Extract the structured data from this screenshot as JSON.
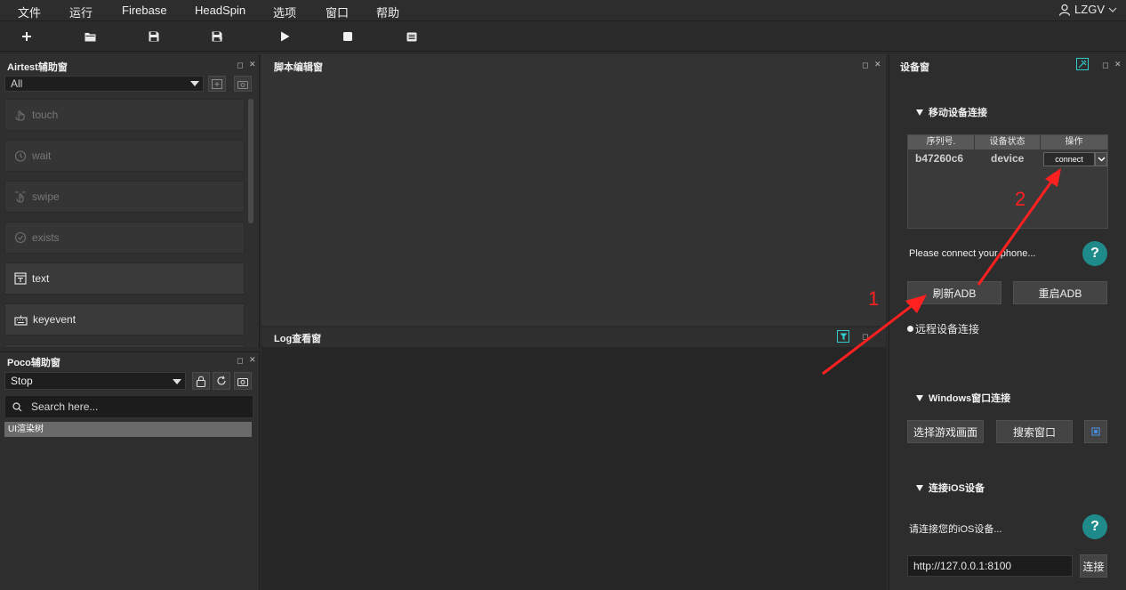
{
  "menubar": {
    "items": [
      "文件",
      "运行",
      "Firebase",
      "HeadSpin",
      "选项",
      "窗口",
      "帮助"
    ],
    "user": "LZGV"
  },
  "toolbar": {
    "buttons": [
      "new-icon",
      "open-folder-icon",
      "save-icon",
      "save-as-icon",
      "play-icon",
      "stop-icon",
      "log-icon"
    ]
  },
  "airtest": {
    "title": "Airtest辅助窗",
    "filter_value": "All",
    "apis": [
      {
        "label": "touch",
        "icon": "hand-icon",
        "enabled": false
      },
      {
        "label": "wait",
        "icon": "clock-icon",
        "enabled": false
      },
      {
        "label": "swipe",
        "icon": "swipe-hand-icon",
        "enabled": false
      },
      {
        "label": "exists",
        "icon": "check-circle-icon",
        "enabled": false
      },
      {
        "label": "text",
        "icon": "text-box-icon",
        "enabled": true
      },
      {
        "label": "keyevent",
        "icon": "keyboard-icon",
        "enabled": true
      }
    ]
  },
  "poco": {
    "title": "Poco辅助窗",
    "mode_value": "Stop",
    "search_placeholder": "Search here...",
    "tree_header": "UI渲染树"
  },
  "editor": {
    "title": "脚本编辑窗"
  },
  "log": {
    "title": "Log查看窗"
  },
  "device": {
    "title": "设备窗",
    "mobile_section": "移动设备连接",
    "table_headers": [
      "序列号.",
      "设备状态",
      "操作"
    ],
    "rows": [
      {
        "serial": "b47260c6",
        "status": "device",
        "action": "connect"
      }
    ],
    "hint": "Please connect your phone...",
    "refresh_adb": "刷新ADB",
    "restart_adb": "重启ADB",
    "remote_section": "远程设备连接",
    "windows_section": "Windows窗口连接",
    "select_game": "选择游戏画面",
    "search_window": "搜索窗口",
    "ios_section": "连接iOS设备",
    "ios_hint": "请连接您的iOS设备...",
    "ios_url": "http://127.0.0.1:8100",
    "ios_connect": "连接"
  },
  "annotations": {
    "label_1": "1",
    "label_2": "2",
    "color": "#ff2020"
  }
}
